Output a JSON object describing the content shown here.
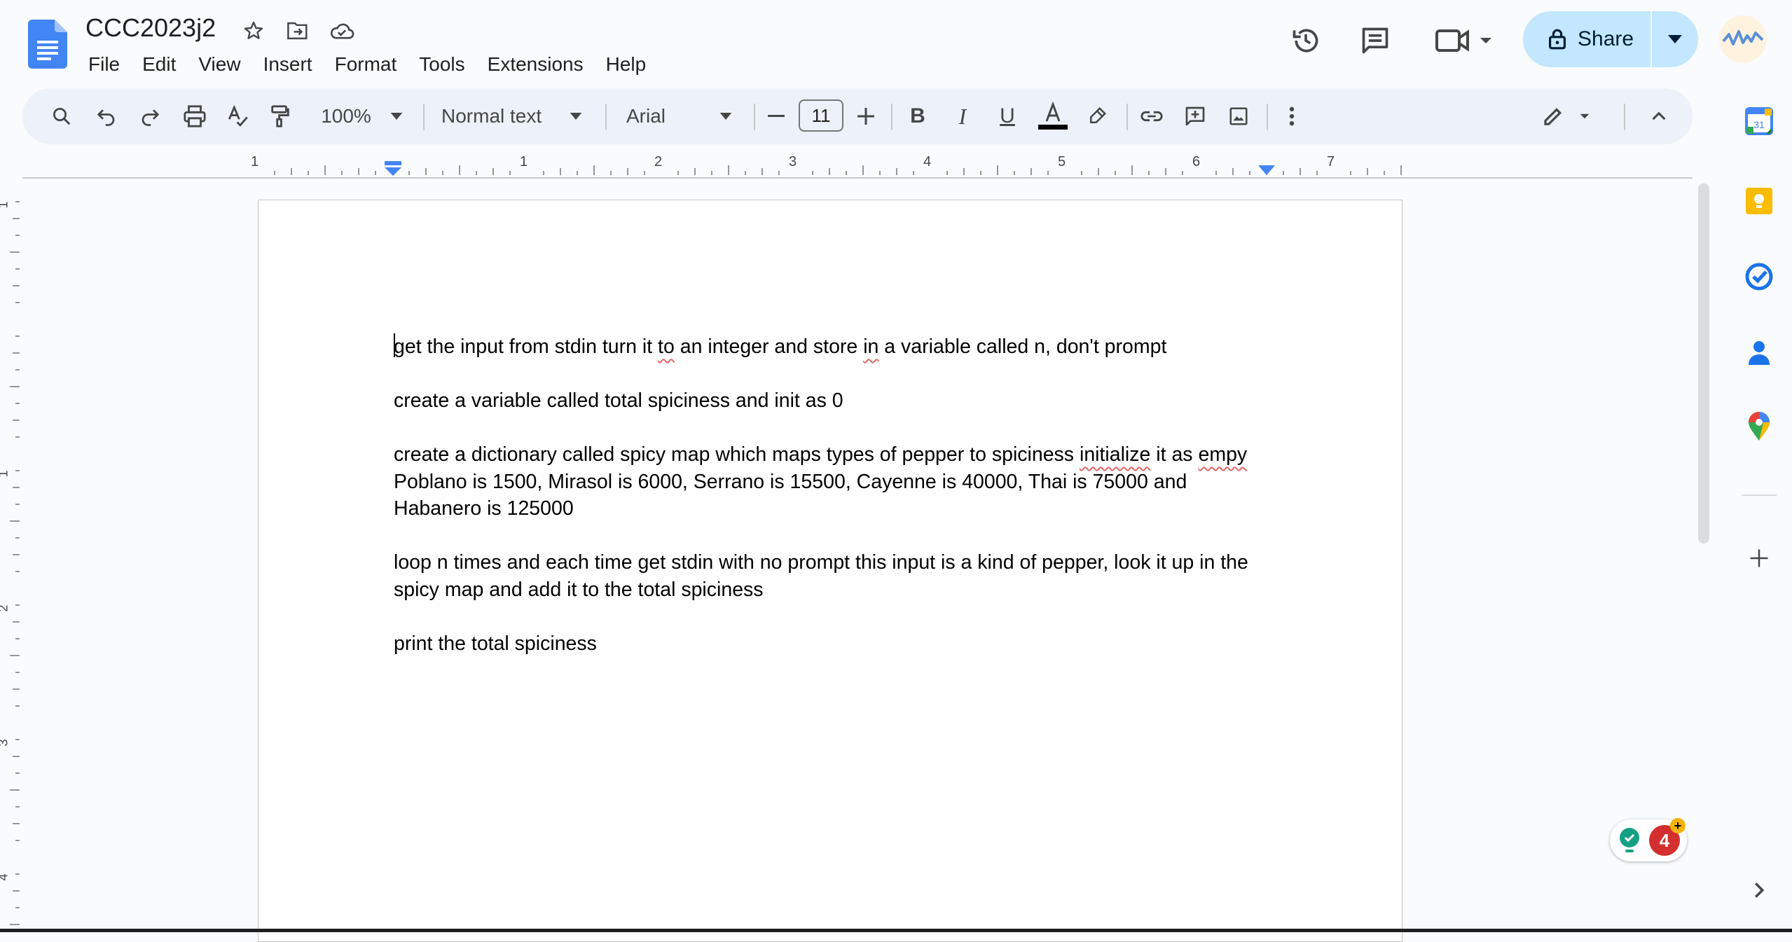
{
  "app": {
    "doc_title": "CCC2023j2",
    "menu": [
      "File",
      "Edit",
      "View",
      "Insert",
      "Format",
      "Tools",
      "Extensions",
      "Help"
    ],
    "share_label": "Share"
  },
  "toolbar": {
    "zoom": "100%",
    "style": "Normal text",
    "font": "Arial",
    "font_size": "11"
  },
  "ruler": {
    "h_labels": [
      "1",
      "1",
      "2",
      "3",
      "4",
      "5",
      "6",
      "7"
    ],
    "v_labels": [
      "1",
      "1",
      "2",
      "3",
      "4"
    ]
  },
  "document": {
    "p1": {
      "first_char": "g",
      "a": "et the input from stdin turn it ",
      "w1": "to",
      "b": " an integer and store ",
      "w2": "in",
      "c": " a variable called n, don't prompt"
    },
    "p2": "create a variable called total spiciness and init as 0",
    "p3": {
      "a": "create a dictionary called spicy map which maps types of pepper to spiciness ",
      "w1": "initialize",
      "b": " it as ",
      "w2": "empy"
    },
    "p4": "Poblano is 1500, Mirasol is 6000, Serrano is 15500, Cayenne is 40000, Thai is 75000 and Habanero is 125000",
    "p5": "loop n times and each time get stdin with no prompt this input is a kind of pepper, look it up in the spicy map and add it to the total spiciness",
    "p6": "print the total spiciness"
  },
  "widget": {
    "badge_count": "4",
    "badge_plus": "+"
  },
  "side_panel": {
    "calendar_day": "31"
  },
  "colors": {
    "accent": "#1a73e8",
    "share_bg": "#c2e7ff",
    "toolbar_bg": "#edf2fa",
    "spell_error": "#e06666"
  },
  "icons": [
    "docs-logo-icon",
    "star-icon",
    "move-folder-icon",
    "cloud-saved-icon",
    "history-icon",
    "comments-icon",
    "meet-icon",
    "lock-icon",
    "search-icon",
    "undo-icon",
    "redo-icon",
    "print-icon",
    "spellcheck-icon",
    "paint-format-icon",
    "bold-icon",
    "italic-icon",
    "underline-icon",
    "text-color-icon",
    "highlight-icon",
    "link-icon",
    "add-comment-icon",
    "insert-image-icon",
    "more-vert-icon",
    "edit-mode-icon",
    "collapse-icon",
    "calendar-icon",
    "keep-icon",
    "tasks-icon",
    "contacts-icon",
    "maps-icon",
    "add-icon",
    "chevron-right-icon"
  ]
}
